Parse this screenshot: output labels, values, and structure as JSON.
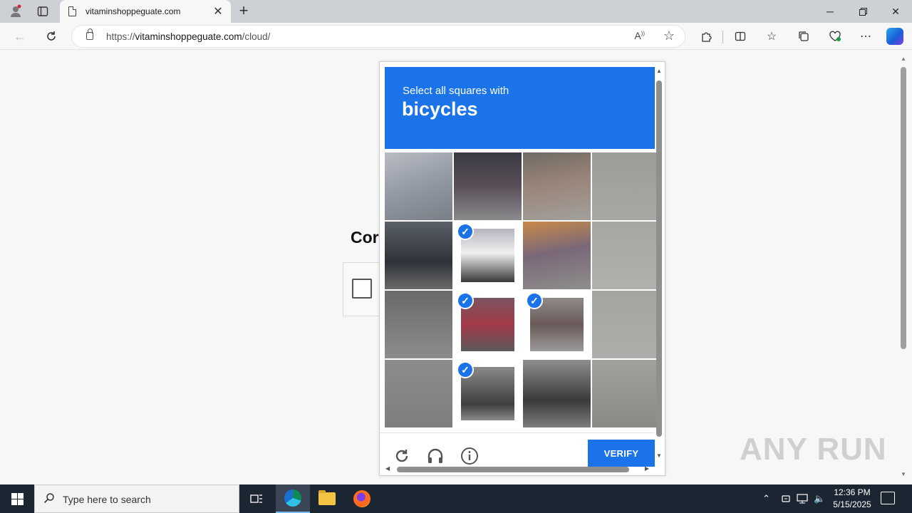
{
  "browser": {
    "tab_title": "vitaminshoppeguate.com",
    "new_tab_symbol": "+",
    "url_prefix": "https://",
    "url_domain": "vitaminshoppeguate.com",
    "url_path": "/cloud/"
  },
  "page": {
    "heading_visible": "Cor"
  },
  "captcha": {
    "instruction": "Select all squares with",
    "target": "bicycles",
    "verify_label": "VERIFY",
    "accent_color": "#1a73e8",
    "tiles": [
      {
        "selected": false
      },
      {
        "selected": false
      },
      {
        "selected": false
      },
      {
        "selected": false
      },
      {
        "selected": false
      },
      {
        "selected": true
      },
      {
        "selected": false
      },
      {
        "selected": false
      },
      {
        "selected": false
      },
      {
        "selected": true
      },
      {
        "selected": true
      },
      {
        "selected": false
      },
      {
        "selected": false
      },
      {
        "selected": true
      },
      {
        "selected": false
      },
      {
        "selected": false
      }
    ],
    "footer_icons": [
      "reload-icon",
      "audio-icon",
      "info-icon"
    ]
  },
  "watermark": "ANY RUN",
  "taskbar": {
    "search_placeholder": "Type here to search",
    "time": "12:36 PM",
    "date": "5/15/2025"
  }
}
